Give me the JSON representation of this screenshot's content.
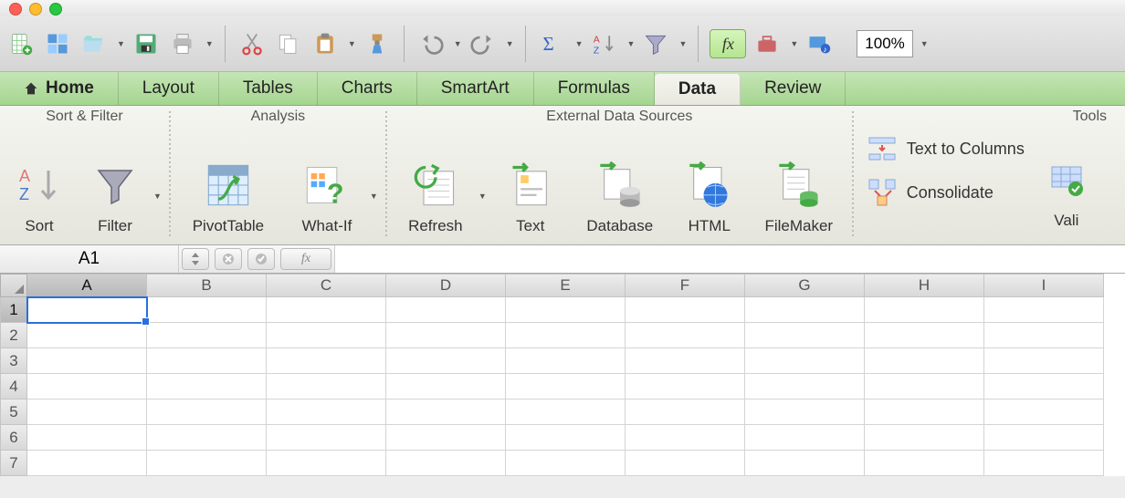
{
  "zoom": "100%",
  "ribbon_tabs": {
    "home": "Home",
    "layout": "Layout",
    "tables": "Tables",
    "charts": "Charts",
    "smartart": "SmartArt",
    "formulas": "Formulas",
    "data": "Data",
    "review": "Review"
  },
  "ribbon_groups": {
    "sort_filter": "Sort & Filter",
    "analysis": "Analysis",
    "external": "External Data Sources",
    "tools": "Tools"
  },
  "buttons": {
    "sort": "Sort",
    "filter": "Filter",
    "pivot": "PivotTable",
    "whatif": "What-If",
    "refresh": "Refresh",
    "text": "Text",
    "database": "Database",
    "html": "HTML",
    "filemaker": "FileMaker",
    "text_to_columns": "Text to Columns",
    "consolidate": "Consolidate",
    "validate": "Vali"
  },
  "formula_bar": {
    "name_box": "A1",
    "fx": "fx"
  },
  "columns": [
    "A",
    "B",
    "C",
    "D",
    "E",
    "F",
    "G",
    "H",
    "I"
  ],
  "rows": [
    "1",
    "2",
    "3",
    "4",
    "5",
    "6",
    "7"
  ],
  "fx_label": "fx"
}
